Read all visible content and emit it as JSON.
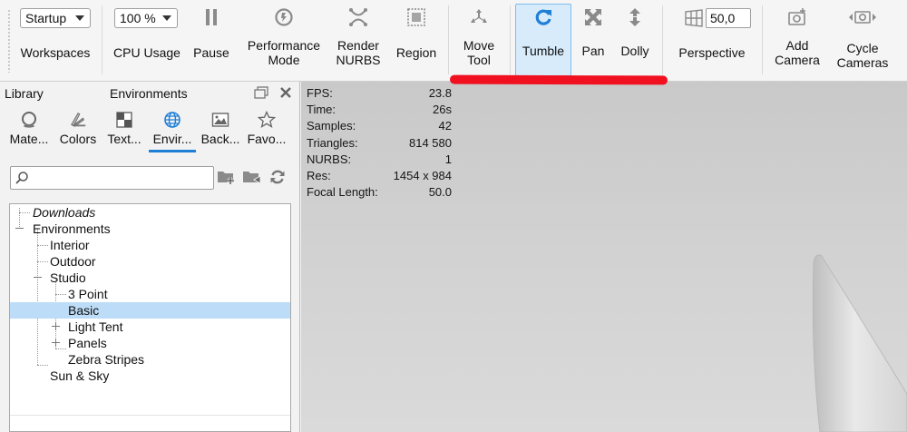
{
  "toolbar": {
    "workspaces": {
      "value": "Startup",
      "label": "Workspaces"
    },
    "cpu_usage": {
      "value": "100 %",
      "label": "CPU Usage"
    },
    "pause": {
      "label": "Pause"
    },
    "performance_mode": {
      "line1": "Performance",
      "line2": "Mode"
    },
    "render_nurbs": {
      "line1": "Render",
      "line2": "NURBS"
    },
    "region": {
      "label": "Region"
    },
    "move_tool": {
      "line1": "Move",
      "line2": "Tool"
    },
    "tumble": {
      "label": "Tumble",
      "active": true
    },
    "pan": {
      "label": "Pan"
    },
    "dolly": {
      "label": "Dolly"
    },
    "perspective": {
      "value": "50,0",
      "label": "Perspective"
    },
    "add_camera": {
      "line1": "Add",
      "line2": "Camera"
    },
    "cycle_cameras": {
      "line1": "Cycle",
      "line2": "Cameras"
    }
  },
  "library": {
    "title": "Library",
    "section": "Environments",
    "tabs": [
      {
        "label": "Mate...",
        "icon": "materials-icon"
      },
      {
        "label": "Colors",
        "icon": "colors-icon"
      },
      {
        "label": "Text...",
        "icon": "textures-icon"
      },
      {
        "label": "Envir...",
        "icon": "environments-icon",
        "active": true
      },
      {
        "label": "Back...",
        "icon": "backplates-icon"
      },
      {
        "label": "Favo...",
        "icon": "favorites-icon"
      }
    ],
    "search": {
      "placeholder": "",
      "value": ""
    },
    "tree": [
      {
        "label": "Downloads"
      },
      {
        "label": "Environments"
      },
      {
        "label": "Interior"
      },
      {
        "label": "Outdoor"
      },
      {
        "label": "Studio"
      },
      {
        "label": "3 Point"
      },
      {
        "label": "Basic",
        "selected": true
      },
      {
        "label": "Light Tent"
      },
      {
        "label": "Panels"
      },
      {
        "label": "Zebra Stripes"
      },
      {
        "label": "Sun & Sky"
      }
    ]
  },
  "viewport": {
    "stats": [
      {
        "key": "FPS:",
        "value": "23.8"
      },
      {
        "key": "Time:",
        "value": "26s"
      },
      {
        "key": "Samples:",
        "value": "42"
      },
      {
        "key": "Triangles:",
        "value": "814 580"
      },
      {
        "key": "NURBS:",
        "value": "1"
      },
      {
        "key": "Res:",
        "value": "1454 x 984"
      },
      {
        "key": "Focal Length:",
        "value": "50.0"
      }
    ]
  },
  "colors": {
    "accent": "#1f7fd6",
    "active_tool_bg": "#d7ebfb",
    "annotation_red": "#f01020",
    "selection_bg": "#bcdcf7",
    "viewport_bg": "#cfcfcf"
  }
}
